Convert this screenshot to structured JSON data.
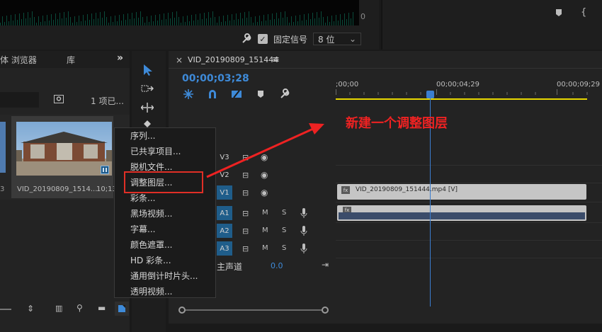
{
  "top": {
    "scope_zero": "0",
    "fixed_signal_label": "固定信号",
    "fixed_signal_checked": "✓",
    "bit_depth_value": "8 位",
    "bit_depth_arrow": "⌄"
  },
  "project": {
    "tab_browser": "体 浏览器",
    "tab_library": "库",
    "more_panels": "»",
    "items_count": "1 项已...",
    "clip_name": "VID_20190809_1514...",
    "clip_duration": "10;13",
    "prev_clip_duration": "3"
  },
  "timeline": {
    "close": "×",
    "sequence_name": "VID_20190809_151444",
    "menu_glyph": "≡",
    "timecode": "00;00;03;28",
    "ruler_labels": [
      ";00;00",
      "00;00;04;29",
      "00;00;09;29"
    ],
    "tracks": {
      "v3": "V3",
      "v2": "V2",
      "v1": "V1",
      "a1": "A1",
      "a2": "A2",
      "a3": "A3"
    },
    "mute_label": "M",
    "solo_label": "S",
    "master_label": "主声道",
    "master_value": "0.0",
    "video_clip_label": "VID_20190809_151444.mp4 [V]",
    "fx_badge": "fx"
  },
  "context_menu": {
    "items": [
      "序列...",
      "已共享项目...",
      "脱机文件...",
      "调整图层...",
      "彩条...",
      "黑场视频...",
      "字幕...",
      "颜色遮罩...",
      "HD 彩条...",
      "通用倒计时片头...",
      "透明视频..."
    ]
  },
  "annotation": {
    "text": "新建一个调整图层"
  },
  "colors": {
    "accent_blue": "#3b7ed1",
    "track_on": "#1f5d8a",
    "annotation_red": "#ee2222",
    "work_area_yellow": "#e8d800"
  }
}
